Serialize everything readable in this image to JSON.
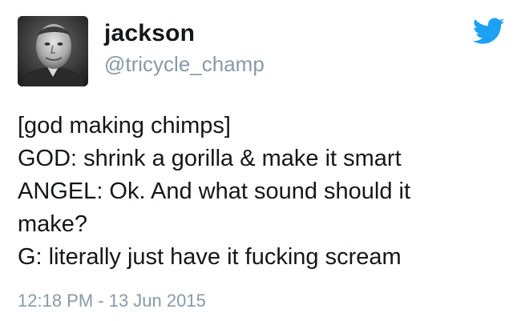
{
  "author": {
    "display_name": "jackson",
    "handle": "@tricycle_champ",
    "avatar_icon": "profile-photo"
  },
  "brand": {
    "icon": "twitter-bird-icon",
    "color": "#1da1f2"
  },
  "tweet": {
    "lines": [
      "[god making chimps]",
      "GOD: shrink a gorilla & make it smart",
      "ANGEL: Ok. And what sound should it",
      "make?",
      "G: literally just have it fucking scream"
    ],
    "timestamp": "12:18 PM - 13 Jun 2015"
  },
  "colors": {
    "text": "#14171a",
    "secondary": "#8899a6"
  }
}
